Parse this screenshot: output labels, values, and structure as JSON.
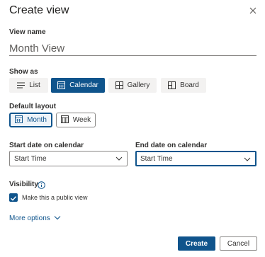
{
  "dialog": {
    "title": "Create view",
    "close_icon": "close-icon"
  },
  "view_name": {
    "label": "View name",
    "value": "Month View"
  },
  "show_as": {
    "label": "Show as",
    "options": [
      {
        "label": "List",
        "icon": "list-icon",
        "selected": false
      },
      {
        "label": "Calendar",
        "icon": "calendar-icon",
        "selected": true
      },
      {
        "label": "Gallery",
        "icon": "gallery-icon",
        "selected": false
      },
      {
        "label": "Board",
        "icon": "board-icon",
        "selected": false
      }
    ]
  },
  "default_layout": {
    "label": "Default layout",
    "options": [
      {
        "label": "Month",
        "icon": "month-calendar-icon",
        "selected": true
      },
      {
        "label": "Week",
        "icon": "week-calendar-icon",
        "selected": false
      }
    ]
  },
  "start_date": {
    "label": "Start date on calendar",
    "value": "Start Time"
  },
  "end_date": {
    "label": "End date on calendar",
    "value": "Start Time"
  },
  "visibility": {
    "label": "Visibility",
    "info_icon": "info-icon",
    "public_checkbox": {
      "label": "Make this a public view",
      "checked": true
    }
  },
  "more_options": {
    "label": "More options"
  },
  "buttons": {
    "create": "Create",
    "cancel": "Cancel"
  },
  "colors": {
    "accent": "#0f548c",
    "border": "#8a8886",
    "neutral_bg": "#f3f2f1"
  }
}
